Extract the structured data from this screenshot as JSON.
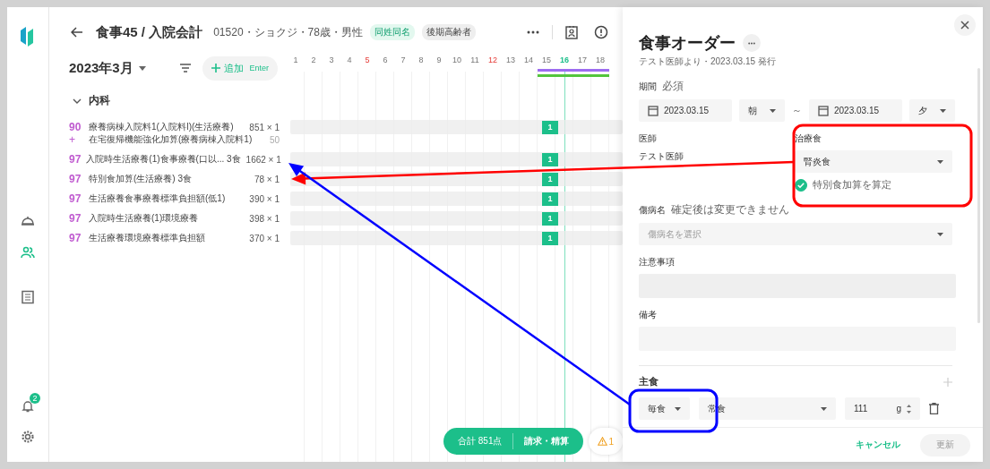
{
  "sidebar": {
    "items": [
      {
        "selected": false
      },
      {
        "selected": true
      },
      {
        "selected": false
      }
    ],
    "notification_badge": "2"
  },
  "header": {
    "title": "食事45 / 入院会計",
    "patient": "01520・ショクジ・78歳・男性",
    "tags": [
      {
        "label": "同姓同名",
        "kind": "accent"
      },
      {
        "label": "後期高齢者",
        "kind": "plain"
      }
    ]
  },
  "toolbar": {
    "month": "2023年3月",
    "add_button": "追加",
    "add_shortcut": "Enter"
  },
  "days": [
    {
      "label": "1",
      "kind": "normal",
      "in_period": false
    },
    {
      "label": "2",
      "kind": "normal",
      "in_period": false
    },
    {
      "label": "3",
      "kind": "normal",
      "in_period": false
    },
    {
      "label": "4",
      "kind": "normal",
      "in_period": false
    },
    {
      "label": "5",
      "kind": "sunday",
      "in_period": false
    },
    {
      "label": "6",
      "kind": "normal",
      "in_period": false
    },
    {
      "label": "7",
      "kind": "normal",
      "in_period": false
    },
    {
      "label": "8",
      "kind": "normal",
      "in_period": false
    },
    {
      "label": "9",
      "kind": "normal",
      "in_period": false
    },
    {
      "label": "10",
      "kind": "normal",
      "in_period": false
    },
    {
      "label": "11",
      "kind": "normal",
      "in_period": false
    },
    {
      "label": "12",
      "kind": "sunday",
      "in_period": false
    },
    {
      "label": "13",
      "kind": "normal",
      "in_period": false
    },
    {
      "label": "14",
      "kind": "normal",
      "in_period": false
    },
    {
      "label": "15",
      "kind": "normal",
      "in_period": true
    },
    {
      "label": "16",
      "kind": "today",
      "in_period": true
    },
    {
      "label": "17",
      "kind": "normal",
      "in_period": true
    },
    {
      "label": "18",
      "kind": "normal",
      "in_period": true
    }
  ],
  "group": {
    "label": "内科",
    "expanded": true
  },
  "rows": [
    {
      "kind": "item",
      "code": "90",
      "name": "療養病棟入院料1(入院料I)(生活療養)",
      "amount": "851 × 1",
      "mark": "1"
    },
    {
      "kind": "addon",
      "code": "+",
      "name": "在宅復帰機能強化加算(療養病棟入院料1)",
      "amount": "50"
    },
    {
      "kind": "item",
      "code": "97",
      "name": "入院時生活療養(1)食事療養(口以... 3食",
      "amount": "1662 × 1",
      "mark": "1"
    },
    {
      "kind": "item",
      "code": "97",
      "name": "特別食加算(生活療養) 3食",
      "amount": "78 × 1",
      "mark": "1"
    },
    {
      "kind": "item",
      "code": "97",
      "name": "生活療養食事療養標準負担額(低1)",
      "amount": "390 × 1",
      "mark": "1"
    },
    {
      "kind": "item",
      "code": "97",
      "name": "入院時生活療養(1)環境療養",
      "amount": "398 × 1",
      "mark": "1"
    },
    {
      "kind": "item",
      "code": "97",
      "name": "生活療養環境療養標準負担額",
      "amount": "370 × 1",
      "mark": "1"
    }
  ],
  "summary": {
    "total": "合計 851点",
    "action": "請求・精算",
    "warning": "1"
  },
  "panel": {
    "title": "食事オーダー",
    "subtitle": "テスト医師より・2023.03.15 発行",
    "period": {
      "label": "期間",
      "hint": "必須",
      "from_date": "2023.03.15",
      "from_meal": "朝",
      "separator": "～",
      "to_date": "2023.03.15",
      "to_meal": "夕"
    },
    "doctor": {
      "label": "医師",
      "value": "テスト医師"
    },
    "therapeutic": {
      "label": "治療食",
      "value": "腎炎食",
      "checked": true,
      "check_label": "特別食加算を算定"
    },
    "disease": {
      "label": "傷病名",
      "hint": "確定後は変更できません",
      "placeholder": "傷病名を選択"
    },
    "notes": {
      "label": "注意事項"
    },
    "remarks": {
      "label": "備考"
    },
    "staple": {
      "label": "主食",
      "frequency": "毎食",
      "type": "常食",
      "amount": "111",
      "unit": "g"
    },
    "cancel": "キャンセル",
    "update": {
      "label": "更新",
      "disabled": true
    }
  },
  "annotations": {
    "frames": [
      {
        "color": "#ff0000"
      },
      {
        "color": "#0000ff"
      }
    ],
    "arrows": [
      {
        "color": "#ff0000"
      },
      {
        "color": "#0000ff"
      }
    ]
  }
}
